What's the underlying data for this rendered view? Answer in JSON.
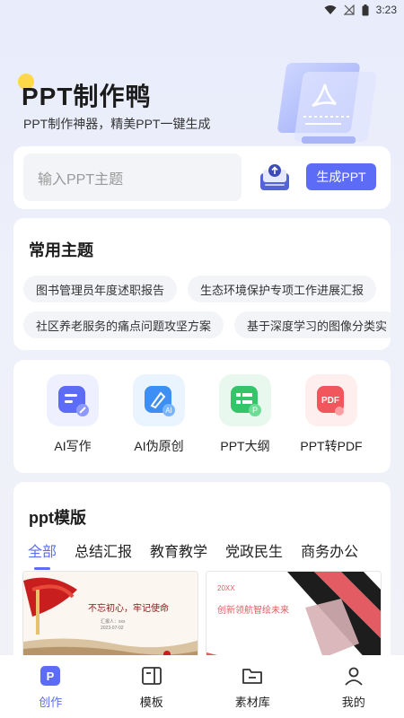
{
  "status_bar": {
    "time": "3:23"
  },
  "hero": {
    "title": "PPT制作鸭",
    "subtitle": "PPT制作神器，精美PPT一键生成"
  },
  "search": {
    "placeholder": "输入PPT主题",
    "generate_label": "生成PPT"
  },
  "topics": {
    "title": "常用主题",
    "chips": [
      "图书管理员年度述职报告",
      "生态环境保护专项工作进展汇报",
      "社区养老服务的痛点问题攻坚方案",
      "基于深度学习的图像分类实"
    ]
  },
  "tools": [
    {
      "label": "AI写作",
      "icon": "ai-writing-icon",
      "color": "#5c6cf6"
    },
    {
      "label": "AI伪原创",
      "icon": "ai-rewrite-icon",
      "color": "#3d8ff5"
    },
    {
      "label": "PPT大纲",
      "icon": "ppt-outline-icon",
      "color": "#34c46a"
    },
    {
      "label": "PPT转PDF",
      "icon": "ppt-to-pdf-icon",
      "color": "#f0565b"
    }
  ],
  "templates": {
    "title": "ppt模版",
    "tabs": [
      "全部",
      "总结汇报",
      "教育教学",
      "党政民生",
      "商务办公"
    ],
    "active_tab": 0,
    "items": [
      {
        "heading": "不忘初心，牢记使命",
        "sub": "汇报人：xxx",
        "date": "2023-07-02"
      },
      {
        "year": "20XX",
        "heading": "创新领航智绘未来"
      }
    ]
  },
  "nav": {
    "items": [
      "创作",
      "模板",
      "素材库",
      "我的"
    ],
    "active": 0
  },
  "colors": {
    "accent": "#5c6cf6"
  }
}
